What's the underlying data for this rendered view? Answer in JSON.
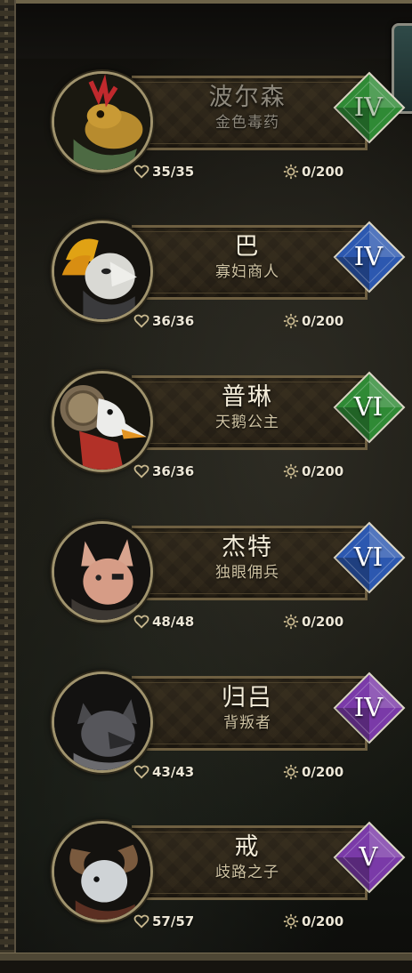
{
  "roster": [
    {
      "name": "波尔森",
      "title": "金色毒药",
      "rank": "IV",
      "rank_color": "#2f8a35",
      "hp": "35/35",
      "xp": "0/200",
      "portrait": "toad-icon",
      "dimmed": true
    },
    {
      "name": "巴",
      "title": "寡妇商人",
      "rank": "IV",
      "rank_color": "#2c58b0",
      "hp": "36/36",
      "xp": "0/200",
      "portrait": "cat-feather-icon",
      "dimmed": false
    },
    {
      "name": "普琳",
      "title": "天鹅公主",
      "rank": "VI",
      "rank_color": "#2f8a35",
      "hp": "36/36",
      "xp": "0/200",
      "portrait": "swan-icon",
      "dimmed": false
    },
    {
      "name": "杰特",
      "title": "独眼佣兵",
      "rank": "VI",
      "rank_color": "#2c58b0",
      "hp": "48/48",
      "xp": "0/200",
      "portrait": "fox-icon",
      "dimmed": false
    },
    {
      "name": "归吕",
      "title": "背叛者",
      "rank": "IV",
      "rank_color": "#7a3aa8",
      "hp": "43/43",
      "xp": "0/200",
      "portrait": "wolf-icon",
      "dimmed": false
    },
    {
      "name": "戒",
      "title": "歧路之子",
      "rank": "V",
      "rank_color": "#7a3aa8",
      "hp": "57/57",
      "xp": "0/200",
      "portrait": "ram-icon",
      "dimmed": false
    }
  ],
  "icons": {
    "health": "heart-icon",
    "experience": "sun-icon"
  }
}
